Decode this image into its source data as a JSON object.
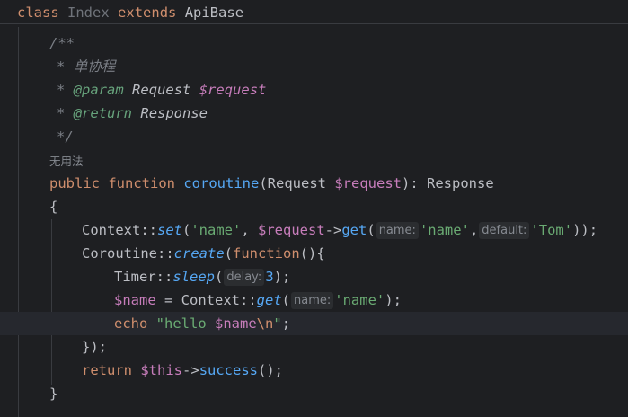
{
  "header": {
    "kw_class": "class",
    "class_name": "Index",
    "kw_extends": "extends",
    "base_class": "ApiBase"
  },
  "doc": {
    "open": "/**",
    "summary_star": "*",
    "summary": "单协程",
    "param_star": "*",
    "param_tag": "@param",
    "param_type": "Request",
    "param_var": "$request",
    "return_star": "*",
    "return_tag": "@return",
    "return_type": "Response",
    "close": "*/"
  },
  "usage_hint": "无用法",
  "signature": {
    "kw_public": "public",
    "kw_function": "function",
    "name": "coroutine",
    "paren_open": "(Request ",
    "param_var": "$request",
    "paren_close": "): Response"
  },
  "code": {
    "brace_open": "{",
    "l1_ctx": "Context::",
    "l1_set": "set",
    "l1_p1": "(",
    "l1_str_name": "'name'",
    "l1_comma": ", ",
    "l1_req": "$request",
    "l1_arrow": "->",
    "l1_get": "get",
    "l1_p2": "(",
    "l1_hint_name": "name:",
    "l1_str_name2": "'name'",
    "l1_comma2": ",",
    "l1_hint_default": "default:",
    "l1_str_tom": "'Tom'",
    "l1_end": "));",
    "l2_co": "Coroutine::",
    "l2_create": "create",
    "l2_p": "(",
    "l2_fn": "function",
    "l2_end": "(){",
    "l3_timer": "Timer::",
    "l3_sleep": "sleep",
    "l3_p": "(",
    "l3_hint_delay": "delay:",
    "l3_num": "3",
    "l3_end": ");",
    "l4_name_var": "$name",
    "l4_eq": " = Context::",
    "l4_get": "get",
    "l4_p": "(",
    "l4_hint_name": "name:",
    "l4_str": "'name'",
    "l4_end": ");",
    "l5_echo": "echo",
    "l5_q1": "\"hello ",
    "l5_var": "$name",
    "l5_esc": "\\n",
    "l5_q2": "\"",
    "l5_end": ";",
    "l6_close": "});",
    "l7_return": "return",
    "l7_this": "$this",
    "l7_arrow": "->",
    "l7_success": "success",
    "l7_end": "();",
    "brace_close": "}"
  },
  "colors": {
    "background": "#1e1f22",
    "keyword": "#cf8e6d",
    "function": "#56a8f5",
    "variable": "#c77dbb",
    "string": "#6aab73",
    "comment": "#7a7e85",
    "doc_tag": "#67a37c"
  }
}
